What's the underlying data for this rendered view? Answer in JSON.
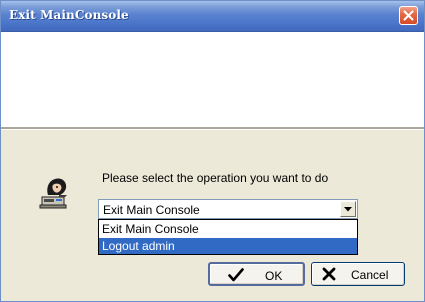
{
  "window": {
    "title": "Exit MainConsole"
  },
  "dialog": {
    "prompt": "Please select the operation you want to do",
    "operation_select": {
      "selected": "Exit Main Console",
      "options": [
        "Exit Main Console",
        "Logout admin"
      ],
      "highlighted_index": 1
    },
    "ok_label": "OK",
    "cancel_label": "Cancel"
  },
  "icons": {
    "close": "close-icon",
    "app": "user-computer-icon",
    "dropdown": "chevron-down-icon",
    "ok": "checkmark-icon",
    "cancel": "x-mark-icon"
  },
  "colors": {
    "titlebar": "#4a75c9",
    "selection": "#316ac5",
    "close_button": "#e05a36",
    "dialog_face": "#ece9d8"
  }
}
